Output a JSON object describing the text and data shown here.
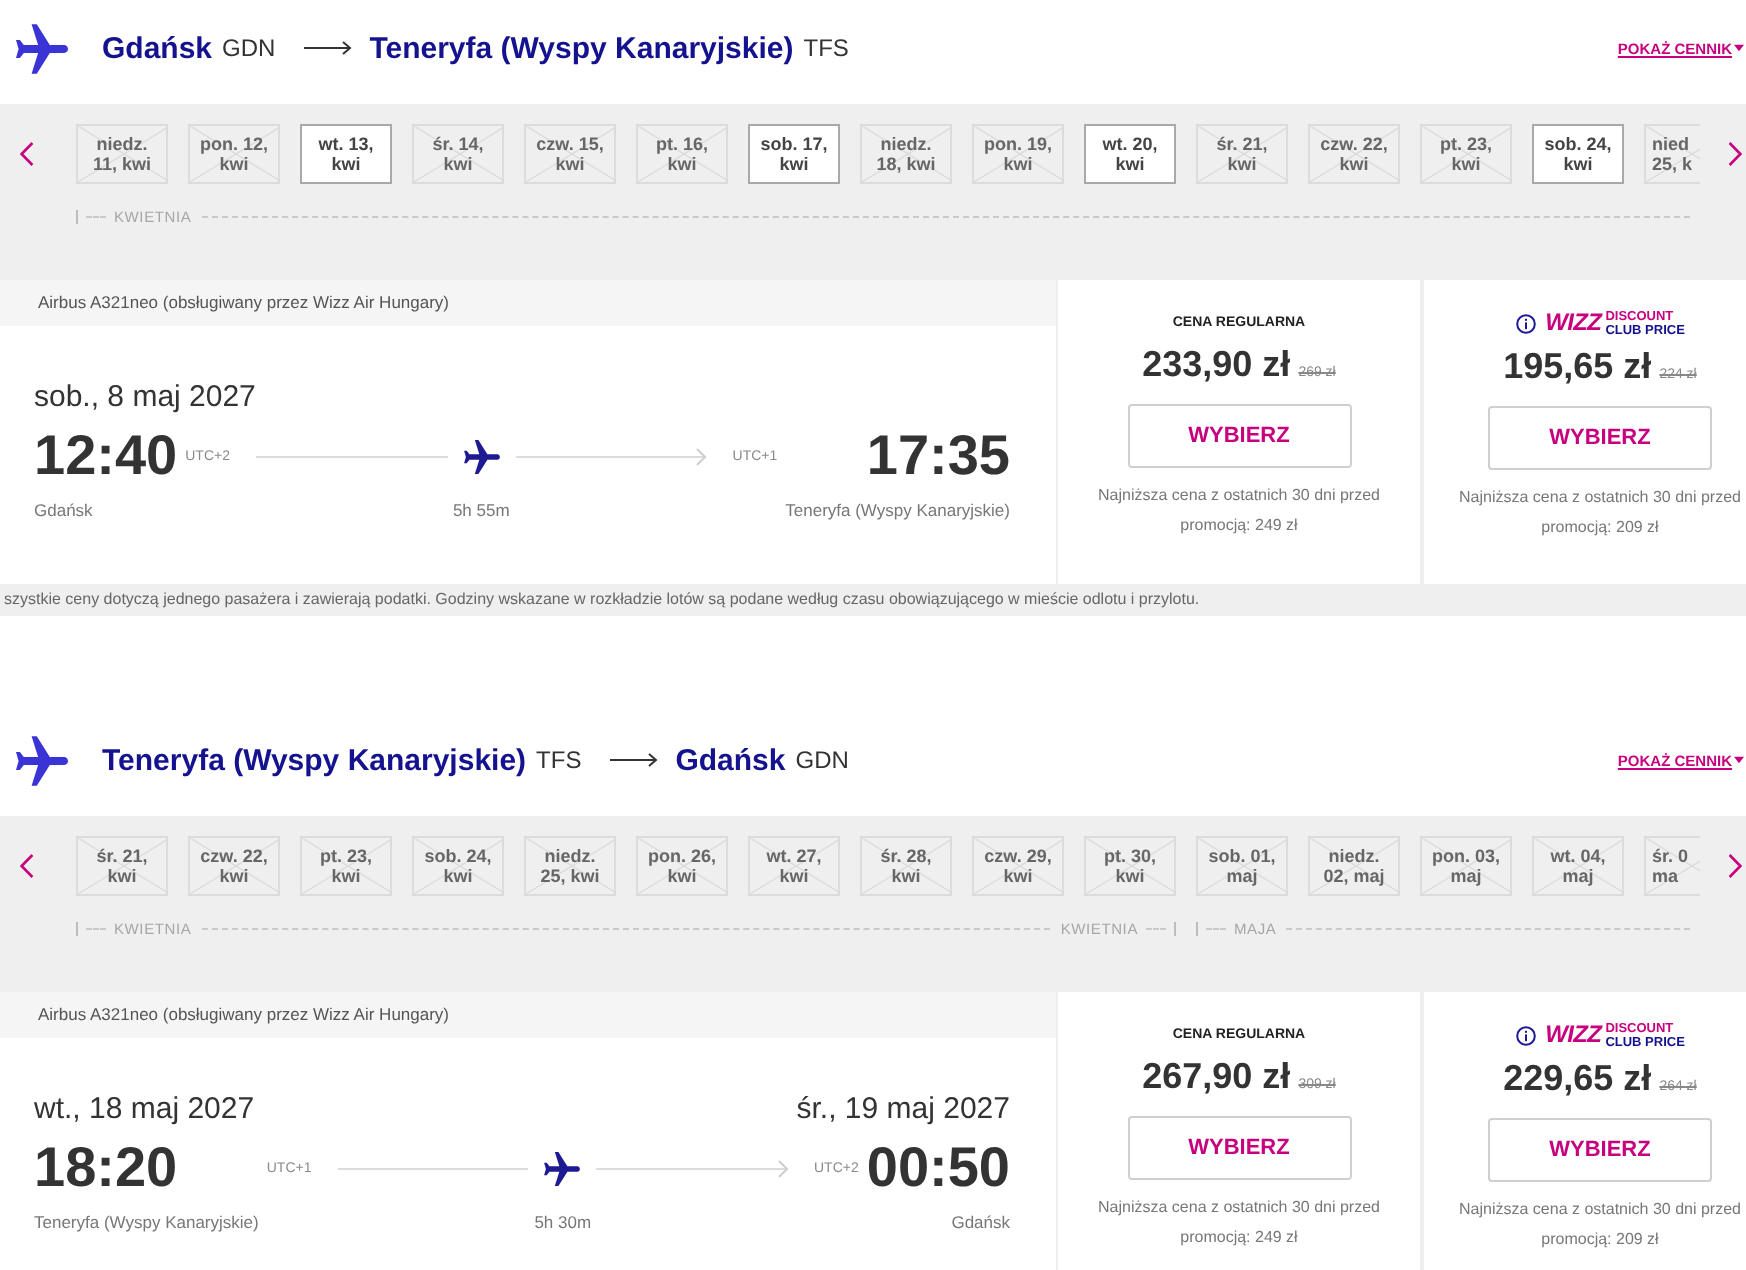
{
  "flights": [
    {
      "header": {
        "origin": "Gdańsk",
        "origin_code": "GDN",
        "destination": "Teneryfa (Wyspy Kanaryjskie)",
        "destination_code": "TFS",
        "link": "POKAŻ CENNIK"
      },
      "date_strip": {
        "months": [
          {
            "label": "KWIETNIA",
            "dates": [
              {
                "lines": [
                  "niedz.",
                  "11, kwi"
                ],
                "disabled": true
              },
              {
                "lines": [
                  "pon. 12,",
                  "kwi"
                ],
                "disabled": true
              },
              {
                "lines": [
                  "wt. 13,",
                  "kwi"
                ],
                "disabled": false
              },
              {
                "lines": [
                  "śr. 14,",
                  "kwi"
                ],
                "disabled": true
              },
              {
                "lines": [
                  "czw. 15,",
                  "kwi"
                ],
                "disabled": true
              },
              {
                "lines": [
                  "pt. 16,",
                  "kwi"
                ],
                "disabled": true
              },
              {
                "lines": [
                  "sob. 17,",
                  "kwi"
                ],
                "disabled": false
              },
              {
                "lines": [
                  "niedz.",
                  "18, kwi"
                ],
                "disabled": true
              },
              {
                "lines": [
                  "pon. 19,",
                  "kwi"
                ],
                "disabled": true
              },
              {
                "lines": [
                  "wt. 20,",
                  "kwi"
                ],
                "disabled": false
              },
              {
                "lines": [
                  "śr. 21,",
                  "kwi"
                ],
                "disabled": true
              },
              {
                "lines": [
                  "czw. 22,",
                  "kwi"
                ],
                "disabled": true
              },
              {
                "lines": [
                  "pt. 23,",
                  "kwi"
                ],
                "disabled": true
              },
              {
                "lines": [
                  "sob. 24,",
                  "kwi"
                ],
                "disabled": false
              },
              {
                "lines": [
                  "nied",
                  "25, k"
                ],
                "disabled": true
              }
            ]
          }
        ]
      },
      "card": {
        "aircraft": "Airbus A321neo (obsługiwany przez Wizz Air Hungary)",
        "departure_date": "sob., 8 maj 2027",
        "departure_time": "12:40",
        "departure_utc": "UTC+2",
        "arrival_utc": "UTC+1",
        "arrival_time": "17:35",
        "origin": "Gdańsk",
        "duration": "5h 55m",
        "destination": "Teneryfa (Wyspy Kanaryjskie)"
      },
      "fares": [
        {
          "kind": "regular",
          "title": "CENA REGULARNA",
          "price": "233,90 zł",
          "old_price": "269 zł",
          "button": "WYBIERZ",
          "note": "Najniższa cena z ostatnich 30 dni przed promocją: 249 zł"
        },
        {
          "kind": "club",
          "logo": "WIZZ",
          "logo_line1": "DISCOUNT",
          "logo_line2": "CLUB PRICE",
          "price": "195,65 zł",
          "old_price": "224 zł",
          "button": "WYBIERZ",
          "note": "Najniższa cena z ostatnich 30 dni przed promocją: 209 zł"
        }
      ],
      "footnote": "szystkie ceny dotyczą jednego pasażera i zawierają podatki. Godziny wskazane w rozkładzie lotów są podane według czasu obowiązującego w mieście odlotu i przylotu."
    },
    {
      "header": {
        "origin": "Teneryfa (Wyspy Kanaryjskie)",
        "origin_code": "TFS",
        "destination": "Gdańsk",
        "destination_code": "GDN",
        "link": "POKAŻ CENNIK"
      },
      "date_strip": {
        "months": [
          {
            "label": "KWIETNIA",
            "end_label": "KWIETNIA",
            "dates": [
              {
                "lines": [
                  "śr. 21,",
                  "kwi"
                ],
                "disabled": true
              },
              {
                "lines": [
                  "czw. 22,",
                  "kwi"
                ],
                "disabled": true
              },
              {
                "lines": [
                  "pt. 23,",
                  "kwi"
                ],
                "disabled": true
              },
              {
                "lines": [
                  "sob. 24,",
                  "kwi"
                ],
                "disabled": true
              },
              {
                "lines": [
                  "niedz.",
                  "25, kwi"
                ],
                "disabled": true
              },
              {
                "lines": [
                  "pon. 26,",
                  "kwi"
                ],
                "disabled": true
              },
              {
                "lines": [
                  "wt. 27,",
                  "kwi"
                ],
                "disabled": true
              },
              {
                "lines": [
                  "śr. 28,",
                  "kwi"
                ],
                "disabled": true
              },
              {
                "lines": [
                  "czw. 29,",
                  "kwi"
                ],
                "disabled": true
              },
              {
                "lines": [
                  "pt. 30,",
                  "kwi"
                ],
                "disabled": true
              }
            ]
          },
          {
            "label": "MAJA",
            "dates": [
              {
                "lines": [
                  "sob. 01,",
                  "maj"
                ],
                "disabled": true
              },
              {
                "lines": [
                  "niedz.",
                  "02, maj"
                ],
                "disabled": true
              },
              {
                "lines": [
                  "pon. 03,",
                  "maj"
                ],
                "disabled": true
              },
              {
                "lines": [
                  "wt. 04,",
                  "maj"
                ],
                "disabled": true
              },
              {
                "lines": [
                  "śr. 0",
                  "ma"
                ],
                "disabled": true
              }
            ]
          }
        ]
      },
      "card": {
        "aircraft": "Airbus A321neo (obsługiwany przez Wizz Air Hungary)",
        "departure_date": "wt., 18 maj 2027",
        "arrival_date": "śr., 19 maj 2027",
        "departure_time": "18:20",
        "departure_utc": "UTC+1",
        "arrival_utc": "UTC+2",
        "arrival_time": "00:50",
        "origin": "Teneryfa (Wyspy Kanaryjskie)",
        "duration": "5h 30m",
        "destination": "Gdańsk"
      },
      "fares": [
        {
          "kind": "regular",
          "title": "CENA REGULARNA",
          "price": "267,90 zł",
          "old_price": "309 zł",
          "button": "WYBIERZ",
          "note": "Najniższa cena z ostatnich 30 dni przed promocją: 249 zł"
        },
        {
          "kind": "club",
          "logo": "WIZZ",
          "logo_line1": "DISCOUNT",
          "logo_line2": "CLUB PRICE",
          "price": "229,65 zł",
          "old_price": "264 zł",
          "button": "WYBIERZ",
          "note": "Najniższa cena z ostatnich 30 dni przed promocją: 209 zł"
        }
      ]
    }
  ]
}
